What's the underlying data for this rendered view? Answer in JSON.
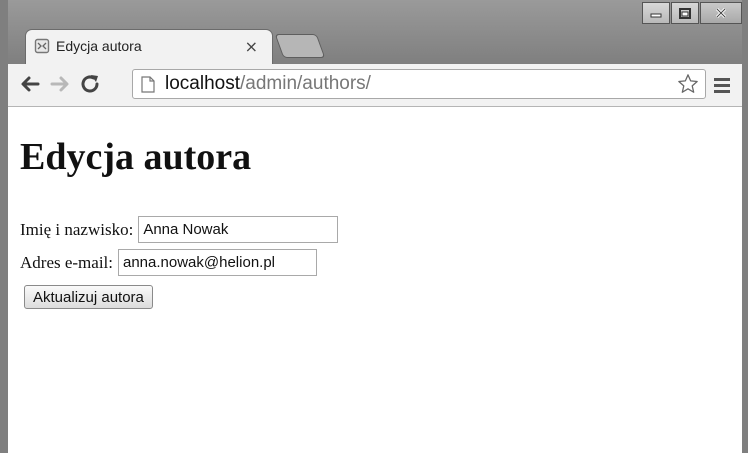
{
  "browser": {
    "tab_title": "Edycja autora",
    "tab_close": "×",
    "url_host": "localhost",
    "url_path": "/admin/authors/"
  },
  "page": {
    "heading": "Edycja autora",
    "name_label": "Imię i nazwisko:",
    "name_value": "Anna Nowak",
    "email_label": "Adres e-mail:",
    "email_value": "anna.nowak@helion.pl",
    "submit_label": "Aktualizuj autora"
  },
  "icons": {
    "favicon": "broken-page-icon",
    "back": "arrow-left-icon",
    "forward": "arrow-right-icon",
    "reload": "reload-icon",
    "page": "document-icon",
    "bookmark": "star-icon",
    "menu": "hamburger-menu-icon",
    "minimize": "minimize-icon",
    "maximize": "maximize-icon",
    "close": "close-icon"
  }
}
